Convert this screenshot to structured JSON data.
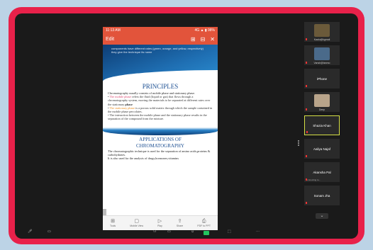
{
  "phone": {
    "status_time": "11:13 AM",
    "status_icons": "4G  ▲ ▮ 98%",
    "edit_label": "Edit",
    "banner_text": "components have different rates (green, orange, and yellow, respectively) they give the technique its name",
    "principles": {
      "title": "PRINCIPLES",
      "intro": "Chromatography usually consists of mobile phase and stationary phase.",
      "b1_lead": "The mobile phase",
      "b1_rest": " refers the fluid (liquid or gas) that flows through a chromatography system, moving the materials to be separated at different rates over the stationary ",
      "b1_bold": "phase",
      "b2_lead": "The stationary phase",
      "b2_rest": " is a porous solid matrix through which the sample contained in the mobile phase percolates.",
      "b3": "The interaction between the mobile phase and the stationary phase results in the separation of the compound from the mixture."
    },
    "applications": {
      "title_line1": "APPLICATIONS OF",
      "title_line2": "CHROMATOGRAPHY",
      "line1": "The chromatographic technique is used for the separation of amino acids,proteins & carbohydrates.",
      "line2": "It is also used for the analysis of drugs,hormones,vitamins"
    },
    "bottom_bar": [
      {
        "icon": "tools-icon",
        "glyph": "⊞",
        "label": "Tools"
      },
      {
        "icon": "mobile-view-icon",
        "glyph": "▢",
        "label": "Mobile View"
      },
      {
        "icon": "play-icon",
        "glyph": "▷",
        "label": "Play"
      },
      {
        "icon": "share-icon",
        "glyph": "⇪",
        "label": "Share"
      },
      {
        "icon": "pdf-icon",
        "glyph": "⎙",
        "label": "PDF to PPT"
      }
    ]
  },
  "participants": [
    {
      "name": "Kaalu@kgmail",
      "type": "photo",
      "color": "#6b5a3a"
    },
    {
      "name": "Vansh@tanmo",
      "type": "photo",
      "color": "#4a6a8a"
    },
    {
      "name": "iPhone",
      "type": "name"
    },
    {
      "name": "Deep",
      "type": "photo",
      "color": "#b8a48a"
    },
    {
      "name": "Shazia Khan",
      "type": "name",
      "active": true
    },
    {
      "name": "Aaliya Najaf",
      "type": "name"
    },
    {
      "name": "Akansha Pal",
      "type": "name",
      "sub": "Connecting to..."
    },
    {
      "name": "Sonam Jha",
      "type": "name"
    }
  ],
  "colors": {
    "frame": "#e8214a",
    "phone_header": "#e2543b",
    "active_speaker": "#d6e046"
  }
}
